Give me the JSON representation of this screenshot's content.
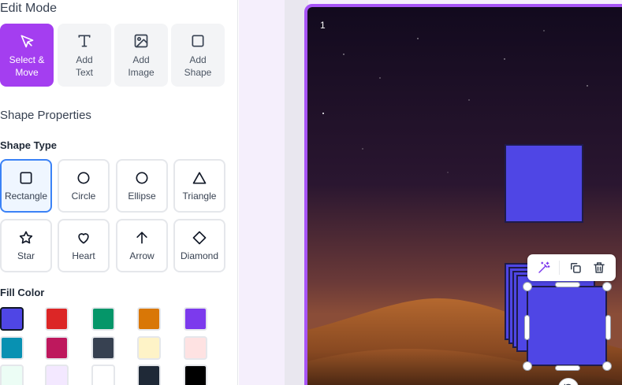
{
  "sidebar": {
    "edit_mode_title": "Edit Mode",
    "modes": [
      {
        "label_line1": "Select &",
        "label_line2": "Move",
        "icon": "cursor-icon",
        "active": true
      },
      {
        "label_line1": "Add",
        "label_line2": "Text",
        "icon": "text-icon",
        "active": false
      },
      {
        "label_line1": "Add",
        "label_line2": "Image",
        "icon": "image-icon",
        "active": false
      },
      {
        "label_line1": "Add",
        "label_line2": "Shape",
        "icon": "square-icon",
        "active": false
      }
    ],
    "shape_properties_title": "Shape Properties",
    "shape_type_label": "Shape Type",
    "shapes": [
      {
        "label": "Rectangle",
        "icon": "rectangle-icon",
        "selected": true
      },
      {
        "label": "Circle",
        "icon": "circle-icon",
        "selected": false
      },
      {
        "label": "Ellipse",
        "icon": "ellipse-icon",
        "selected": false
      },
      {
        "label": "Triangle",
        "icon": "triangle-icon",
        "selected": false
      },
      {
        "label": "Star",
        "icon": "star-icon",
        "selected": false
      },
      {
        "label": "Heart",
        "icon": "heart-icon",
        "selected": false
      },
      {
        "label": "Arrow",
        "icon": "arrow-up-icon",
        "selected": false
      },
      {
        "label": "Diamond",
        "icon": "diamond-icon",
        "selected": false
      }
    ],
    "fill_color_label": "Fill Color",
    "fill_colors": [
      "#4f46e5",
      "#dc2626",
      "#059669",
      "#d97706",
      "#7c3aed",
      "#0891b2",
      "#be185d",
      "#374151",
      "#fef3c7",
      "#fee2e2",
      "#ecfdf5",
      "#f3e8ff",
      "#ffffff",
      "#1f2937",
      "#000000"
    ],
    "selected_fill": "#4f46e5"
  },
  "slide": {
    "number": "1",
    "shape_color": "#4f46e5",
    "toolbar": {
      "magic_icon": "magic-wand-icon",
      "duplicate_icon": "copy-icon",
      "delete_icon": "trash-icon"
    },
    "rotate_icon": "rotate-icon"
  }
}
